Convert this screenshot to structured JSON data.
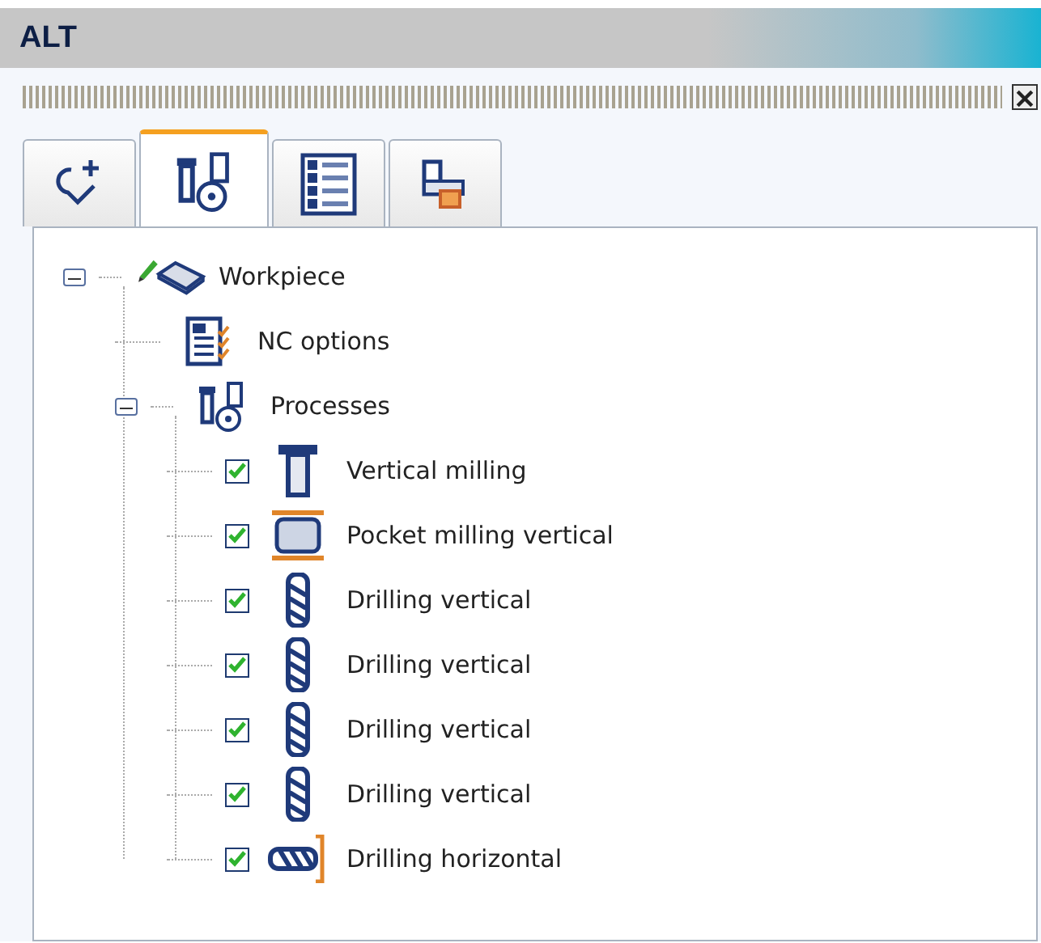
{
  "window": {
    "title": "ALT"
  },
  "tabs": [
    {
      "kind": "contour",
      "selected": false
    },
    {
      "kind": "processes",
      "selected": true
    },
    {
      "kind": "list",
      "selected": false
    },
    {
      "kind": "parts",
      "selected": false
    }
  ],
  "tree": {
    "label": "Workpiece",
    "kind": "workpiece",
    "expanded": true,
    "children": [
      {
        "label": "NC options",
        "kind": "nc-options"
      },
      {
        "label": "Processes",
        "kind": "processes",
        "expanded": true,
        "children": [
          {
            "label": "Vertical milling",
            "kind": "vertical-milling",
            "checked": true
          },
          {
            "label": "Pocket milling vertical",
            "kind": "pocket-milling",
            "checked": true
          },
          {
            "label": "Drilling vertical",
            "kind": "drilling-vertical",
            "checked": true
          },
          {
            "label": "Drilling vertical",
            "kind": "drilling-vertical",
            "checked": true
          },
          {
            "label": "Drilling vertical",
            "kind": "drilling-vertical",
            "checked": true
          },
          {
            "label": "Drilling vertical",
            "kind": "drilling-vertical",
            "checked": true
          },
          {
            "label": "Drilling horizontal",
            "kind": "drilling-horizontal",
            "checked": true
          }
        ]
      }
    ]
  }
}
